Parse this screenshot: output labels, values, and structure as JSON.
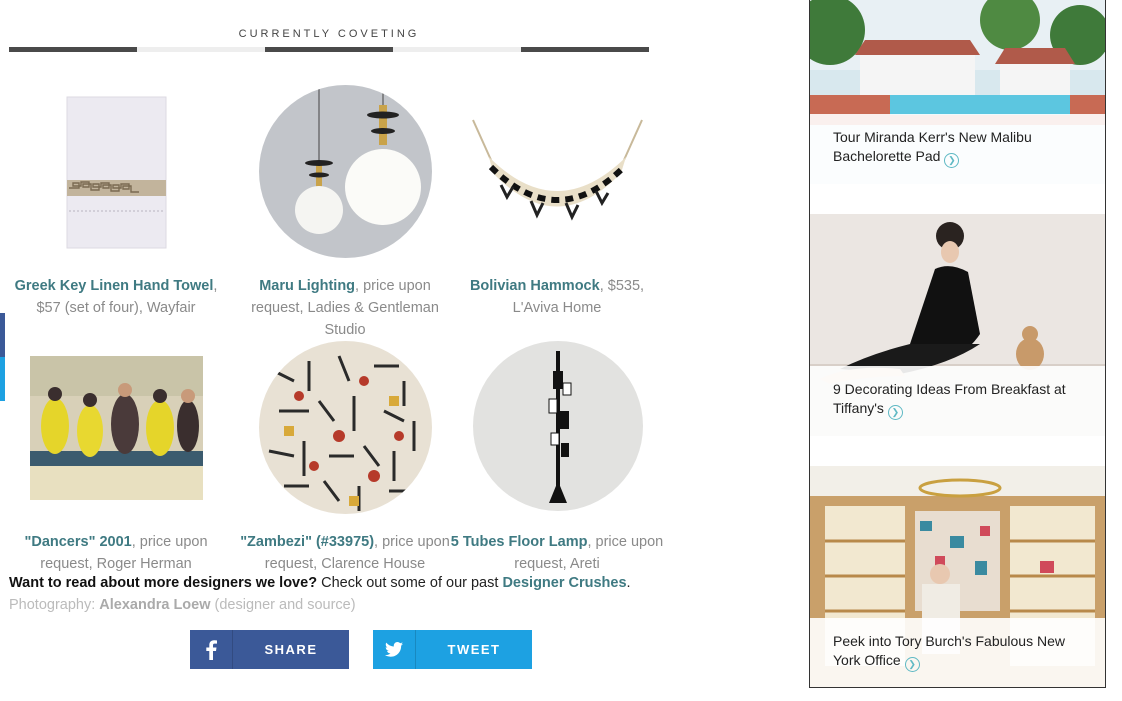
{
  "section_title": "CURRENTLY COVETING",
  "tab_colors": [
    "#4a4a4a",
    "#eeeeee",
    "#4a4a4a",
    "#eeeeee",
    "#4a4a4a"
  ],
  "products": [
    {
      "name": "Greek Key Linen Hand Towel",
      "detail": ", $57 (set of four), Wayfair"
    },
    {
      "name": "Maru Lighting",
      "detail": ", price upon request, Ladies & Gentleman Studio"
    },
    {
      "name": "Bolivian Hammock",
      "detail": ", $535, L'Aviva Home"
    },
    {
      "name": "\"Dancers\" 2001",
      "detail": ", price upon request, Roger Herman"
    },
    {
      "name": "\"Zambezi\" (#33975)",
      "detail": ", price upon request, Clarence House"
    },
    {
      "name": "5 Tubes Floor Lamp",
      "detail": ", price upon request, Areti"
    }
  ],
  "read_more": {
    "lead": "Want to read about more designers we love?",
    "text": " Check out some of our past ",
    "link": "Designer Crushes",
    "end": "."
  },
  "credit": {
    "prefix": "Photography: ",
    "name": "Alexandra Loew",
    "suffix": " (designer and source)"
  },
  "share": {
    "label": "SHARE",
    "icon": "facebook-icon",
    "color": "#3b5998"
  },
  "tweet": {
    "label": "TWEET",
    "icon": "twitter-icon",
    "color": "#1da1e2"
  },
  "sidebar": [
    {
      "title": "Tour Miranda Kerr's New Malibu Bachelorette Pad"
    },
    {
      "title": "9 Decorating Ideas From Breakfast at Tiffany's"
    },
    {
      "title": "Peek into Tory Burch's Fabulous New York Office"
    }
  ],
  "accent_color": "#3f7a82"
}
